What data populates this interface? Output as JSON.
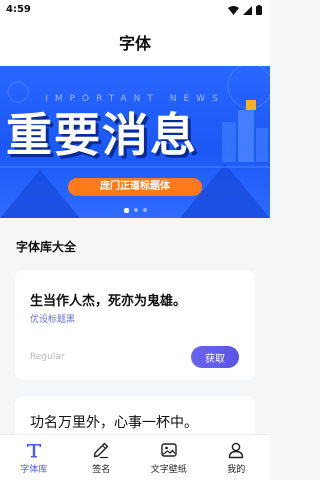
{
  "status_bar": {
    "time": "4:59"
  },
  "header": {
    "title": "字体"
  },
  "banner": {
    "english_text": "IMPORTANT NEWS",
    "headline": "重要消息",
    "font_label": "庞门正道标题体",
    "slide_count": 3,
    "active_slide": 1
  },
  "section": {
    "title": "字体库大全"
  },
  "cards": [
    {
      "sample": "生当作人杰，死亦为鬼雄。",
      "font_name": "优设标题黑",
      "style": "Regular",
      "button_label": "获取"
    },
    {
      "sample": "功名万里外，心事一杯中。"
    }
  ],
  "tabs": [
    {
      "label": "字体库",
      "icon": "font-T-icon",
      "active": true
    },
    {
      "label": "签名",
      "icon": "pen-icon",
      "active": false
    },
    {
      "label": "文字壁纸",
      "icon": "image-icon",
      "active": false
    },
    {
      "label": "我的",
      "icon": "person-icon",
      "active": false
    }
  ],
  "colors": {
    "accent": "#4a5cf0",
    "banner_blue": "#1b58f5",
    "pill_orange": "#ff7a1a",
    "button_purple": "#5a56e6"
  }
}
